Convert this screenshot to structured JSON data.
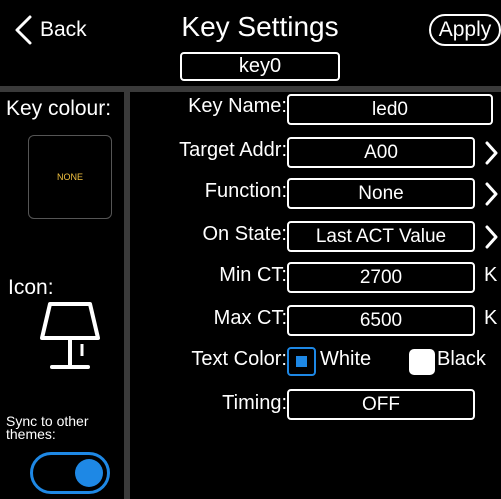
{
  "header": {
    "back_label": "Back",
    "title": "Key Settings",
    "apply_label": "Apply",
    "key_id": "key0"
  },
  "left_panel": {
    "key_colour_label": "Key colour:",
    "colour_swatch_value": "NONE",
    "icon_label": "Icon:",
    "icon_name": "lamp-icon",
    "sync_label": "Sync to other themes:",
    "sync_enabled": true
  },
  "form": {
    "key_name": {
      "label": "Key Name:",
      "value": "led0"
    },
    "target_addr": {
      "label": "Target Addr:",
      "value": "A00"
    },
    "function": {
      "label": "Function:",
      "value": "None"
    },
    "on_state": {
      "label": "On State:",
      "value": "Last ACT Value"
    },
    "min_ct": {
      "label": "Min CT:",
      "value": "2700",
      "unit": "K"
    },
    "max_ct": {
      "label": "Max CT:",
      "value": "6500",
      "unit": "K"
    },
    "text_color": {
      "label": "Text Color:",
      "option_white": "White",
      "option_black": "Black",
      "selected": "White"
    },
    "timing": {
      "label": "Timing:",
      "value": "OFF"
    }
  },
  "colors": {
    "accent": "#1e88e5",
    "background": "#000000",
    "divider": "#3a3a3a",
    "swatch_text": "#f0c040"
  }
}
